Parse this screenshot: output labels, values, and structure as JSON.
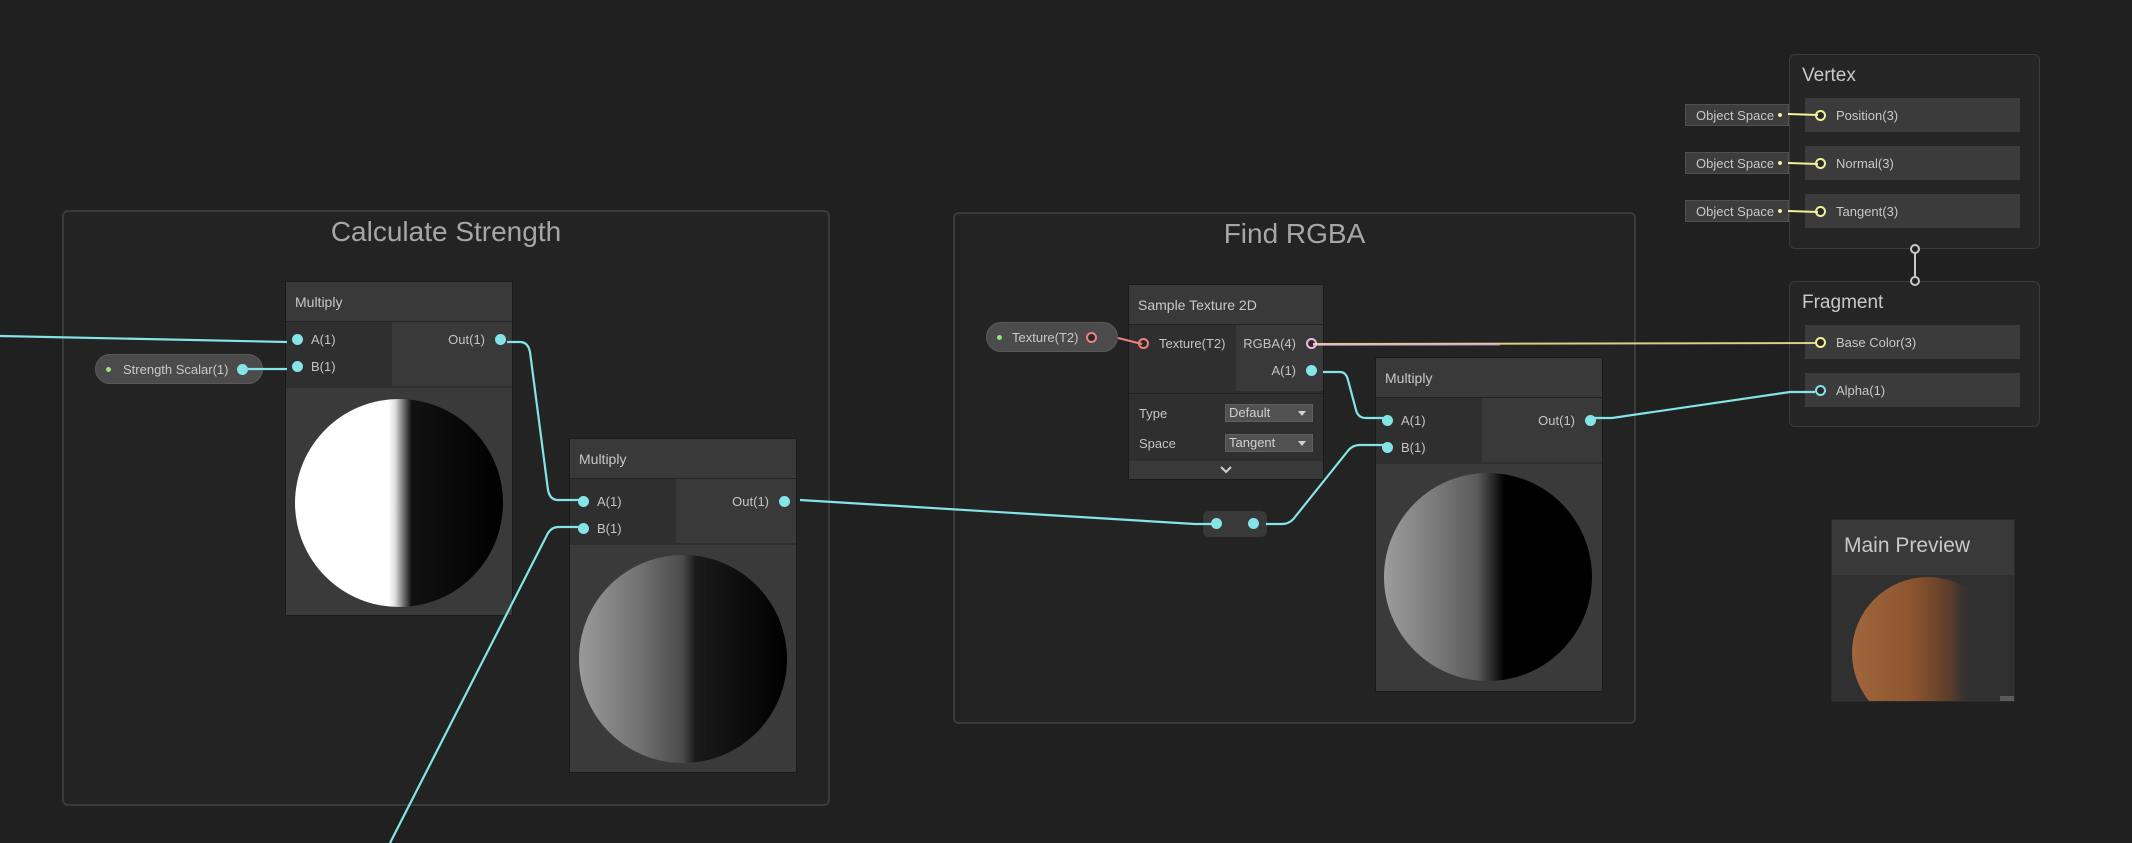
{
  "groups": {
    "calc": {
      "title": "Calculate Strength"
    },
    "rgba": {
      "title": "Find RGBA"
    }
  },
  "nodes": {
    "multiply1": {
      "title": "Multiply",
      "in_a": "A(1)",
      "in_b": "B(1)",
      "out": "Out(1)"
    },
    "multiply2": {
      "title": "Multiply",
      "in_a": "A(1)",
      "in_b": "B(1)",
      "out": "Out(1)"
    },
    "multiply3": {
      "title": "Multiply",
      "in_a": "A(1)",
      "in_b": "B(1)",
      "out": "Out(1)"
    },
    "sample_texture": {
      "title": "Sample Texture 2D",
      "in_texture": "Texture(T2)",
      "out_rgba": "RGBA(4)",
      "out_a": "A(1)",
      "type_label": "Type",
      "type_value": "Default",
      "space_label": "Space",
      "space_value": "Tangent"
    }
  },
  "properties": {
    "strength": "Strength Scalar(1)",
    "texture": "Texture(T2)"
  },
  "master": {
    "vertex": {
      "title": "Vertex",
      "blocks": [
        {
          "label": "Position(3)",
          "space": "Object Space"
        },
        {
          "label": "Normal(3)",
          "space": "Object Space"
        },
        {
          "label": "Tangent(3)",
          "space": "Object Space"
        }
      ]
    },
    "fragment": {
      "title": "Fragment",
      "blocks": [
        {
          "label": "Base Color(3)"
        },
        {
          "label": "Alpha(1)"
        }
      ]
    }
  },
  "main_preview": {
    "title": "Main Preview"
  },
  "colors": {
    "background": "#202020",
    "float_wire": "#84e4e7",
    "vector3_wire": "#f5f09c",
    "texture_port": "#f17f7f",
    "vector4_port": "#f3b4e8",
    "property_dot": "#9ae27a"
  },
  "icons": {
    "expand": "chevron-down-icon",
    "dropdown": "triangle-down-icon"
  }
}
